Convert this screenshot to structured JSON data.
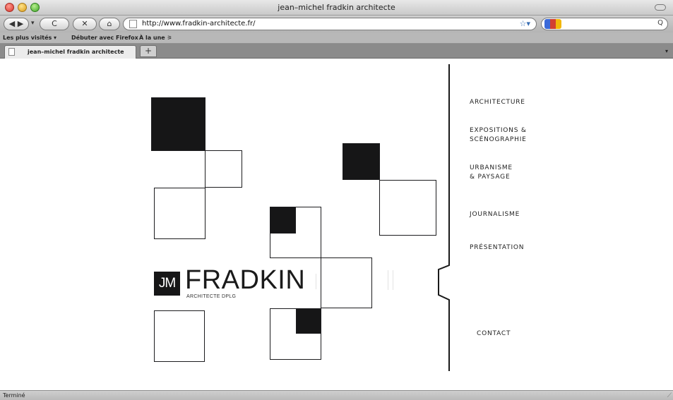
{
  "window": {
    "title": "jean–michel fradkin architecte"
  },
  "toolbar": {
    "back_forward": "◀ ▶",
    "dropdown_mark": "▾",
    "reload": "C",
    "stop": "✕",
    "home": "⌂",
    "url": "http://www.fradkin-architecte.fr/",
    "bookmark_star": "☆▾",
    "search_placeholder": "",
    "search_glass": "Q"
  },
  "bookmarks": {
    "items": [
      "Les plus visités ▾",
      "Débuter avec Firefox",
      "À la une ⚞"
    ]
  },
  "tabs": {
    "active_label": "jean–michel fradkin architecte",
    "new_tab": "+",
    "tab_list": "▾"
  },
  "site": {
    "logo_mark": "JM",
    "logo_name": "FRADKIN",
    "logo_subtitle": "ARCHITECTE DPLG",
    "menu": {
      "architecture": "ARCHITECTURE",
      "expositions_1": "EXPOSITIONS &",
      "expositions_2": "SCÉNOGRAPHIE",
      "urbanisme_1": "URBANISME",
      "urbanisme_2": "& PAYSAGE",
      "journalisme": "JOURNALISME",
      "presentation": "PRÉSENTATION",
      "contact": "CONTACT"
    }
  },
  "status": {
    "text": "Terminé",
    "grip": "⟋"
  }
}
